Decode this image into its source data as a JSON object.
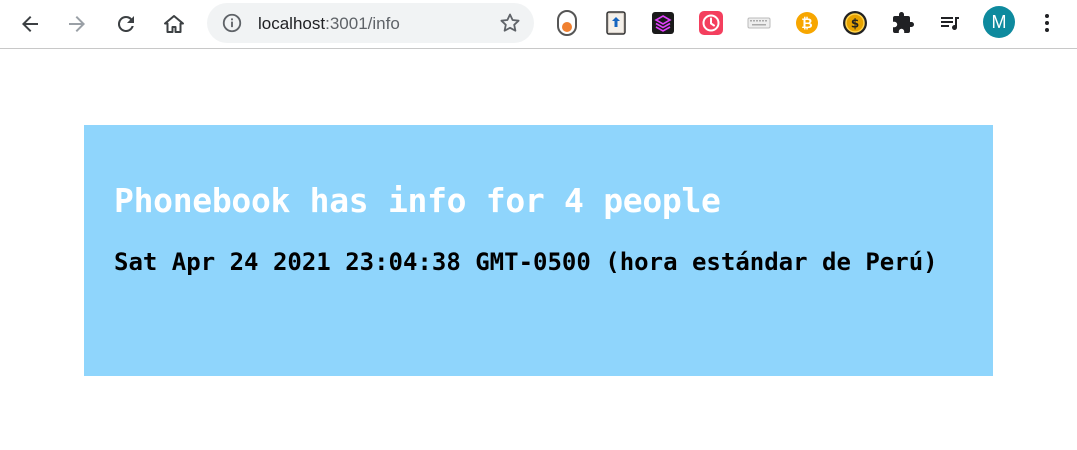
{
  "browser": {
    "url_host": "localhost",
    "url_path": ":3001/info",
    "profile_initial": "M",
    "colors": {
      "avatar": "#0e8a9e",
      "omnibox": "#f1f3f4"
    },
    "extensions": [
      "toggle-extension-icon",
      "book-upload-extension-icon",
      "layers-extension-icon",
      "clock-extension-icon",
      "keyboard-extension-icon",
      "bitcoin-extension-icon",
      "coin-extension-icon",
      "puzzle-icon",
      "media-queue-icon"
    ]
  },
  "page": {
    "heading": "Phonebook has info for 4 people",
    "timestamp": "Sat Apr 24 2021 23:04:38 GMT-0500 (hora estándar de Perú)",
    "colors": {
      "panel_background": "#8fd5fc",
      "heading": "#ffffff",
      "timestamp": "#000000"
    }
  }
}
